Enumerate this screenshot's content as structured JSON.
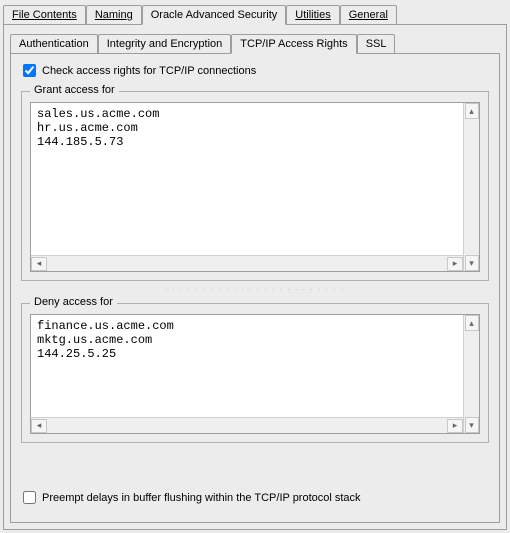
{
  "outerTabs": {
    "fileContents": "File Contents",
    "naming": "Naming",
    "oracleAdvSec": "Oracle Advanced Security",
    "utilities": "Utilities",
    "general": "General"
  },
  "innerTabs": {
    "authentication": "Authentication",
    "integrityEncryption": "Integrity and Encryption",
    "tcpipAccess": "TCP/IP Access Rights",
    "ssl": "SSL"
  },
  "checkAccess": {
    "label": "Check access rights for TCP/IP connections",
    "checked": true
  },
  "grant": {
    "title": "Grant access for",
    "value": "sales.us.acme.com\nhr.us.acme.com\n144.185.5.73"
  },
  "deny": {
    "title": "Deny access for",
    "value": "finance.us.acme.com\nmktg.us.acme.com\n144.25.5.25"
  },
  "preempt": {
    "label": "Preempt delays in buffer flushing within the TCP/IP protocol stack",
    "checked": false
  },
  "glyphs": {
    "left": "◂",
    "right": "▸",
    "up": "▴",
    "down": "▾"
  }
}
